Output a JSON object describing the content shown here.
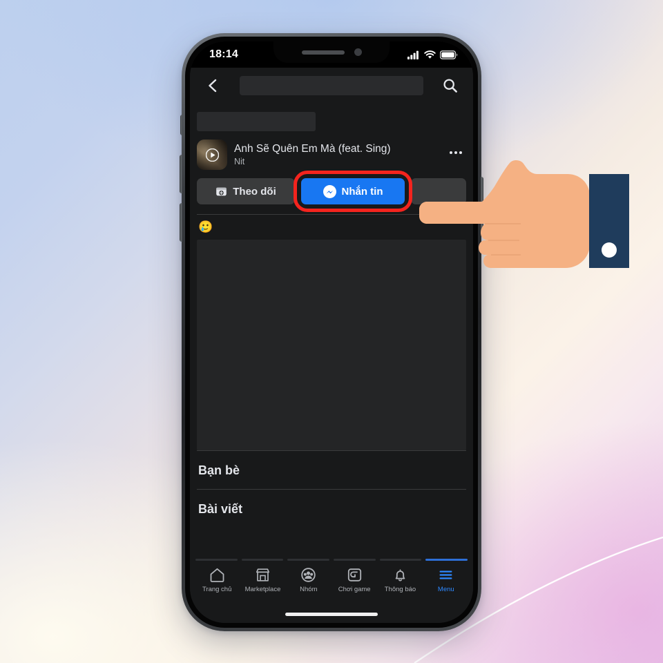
{
  "background": {
    "gradient_start": "#bdd0ee",
    "gradient_mid": "#fbf2e8",
    "gradient_end": "#e8c8ea",
    "swoosh_color": "#ffffff"
  },
  "phone": {
    "frame_color": "#3a3d41",
    "screen_background": "#18191a"
  },
  "status_bar": {
    "time": "18:14",
    "signal_icon": "cellular-signal-icon",
    "wifi_icon": "wifi-icon",
    "battery_icon": "battery-full-icon"
  },
  "app_header": {
    "back_icon": "chevron-left-icon",
    "search_icon": "search-icon",
    "search_value": "",
    "search_placeholder": ""
  },
  "profile": {
    "name_redacted": "",
    "song": {
      "title": "Anh Sẽ Quên Em Mà (feat. Sing)",
      "artist": "Nit",
      "thumbnail_icon": "play-video-thumbnail",
      "play_icon": "play-icon",
      "more_icon": "more-horizontal-icon"
    },
    "actions": [
      {
        "id": "follow",
        "label": "Theo dõi",
        "icon": "add-person-icon",
        "style": "secondary",
        "highlighted": false
      },
      {
        "id": "message",
        "label": "Nhắn tin",
        "icon": "messenger-icon",
        "style": "primary",
        "highlighted": true
      },
      {
        "id": "more",
        "label": "",
        "icon": "more-icon",
        "style": "secondary",
        "highlighted": false
      }
    ],
    "accent_primary": "#1877f2",
    "accent_highlight": "#f4241e",
    "reaction_emoji": "🥲"
  },
  "sections": [
    {
      "id": "friends",
      "title": "Bạn bè"
    },
    {
      "id": "posts",
      "title": "Bài viết"
    }
  ],
  "bottom_nav": {
    "items": [
      {
        "id": "home",
        "label": "Trang chủ",
        "icon": "home-icon",
        "active": false
      },
      {
        "id": "marketplace",
        "label": "Marketplace",
        "icon": "store-icon",
        "active": false
      },
      {
        "id": "groups",
        "label": "Nhóm",
        "icon": "groups-icon",
        "active": false
      },
      {
        "id": "gaming",
        "label": "Chơi game",
        "icon": "gaming-icon",
        "active": false
      },
      {
        "id": "notifications",
        "label": "Thông báo",
        "icon": "bell-icon",
        "active": false
      },
      {
        "id": "menu",
        "label": "Menu",
        "icon": "hamburger-menu-icon",
        "active": true
      }
    ],
    "active_color": "#2d88ff",
    "inactive_color": "#b0b3b8"
  },
  "pointer": {
    "icon": "pointing-hand-icon",
    "skin_color": "#f5b183",
    "sleeve_color": "#1f3c5c",
    "button_color": "#ffffff"
  }
}
